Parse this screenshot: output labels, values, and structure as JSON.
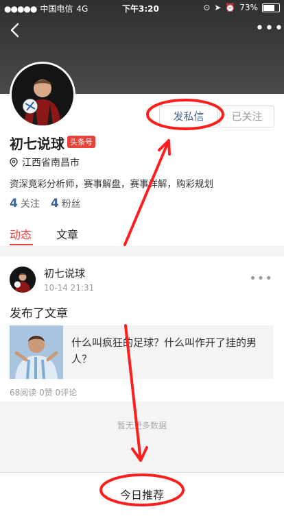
{
  "status_bar": {
    "carrier": "中国电信",
    "network": "4G",
    "time": "下午3:20",
    "battery": "73%"
  },
  "profile": {
    "name": "初七说球",
    "badge": "头条号",
    "location": "江西省南昌市",
    "bio": "资深竞彩分析师，赛事解盘，赛事详解，购彩规划",
    "following_count": "4",
    "following_label": "关注",
    "followers_count": "4",
    "followers_label": "粉丝",
    "message_button": "发私信",
    "followed_button": "已关注"
  },
  "tabs": [
    "动态",
    "文章"
  ],
  "feed": {
    "author": "初七说球",
    "time": "10-14 21:31",
    "text": "发布了文章",
    "article_title": "什么叫疯狂的足球？什么叫作开了挂的男人？",
    "meta": "68阅读  0赞  0评论"
  },
  "no_more": "暂无更多数据",
  "bottom_button": "今日推荐",
  "colors": {
    "accent_red": "#e9443b",
    "link_blue": "#406599",
    "annotation_red": "#ff1e1e"
  }
}
